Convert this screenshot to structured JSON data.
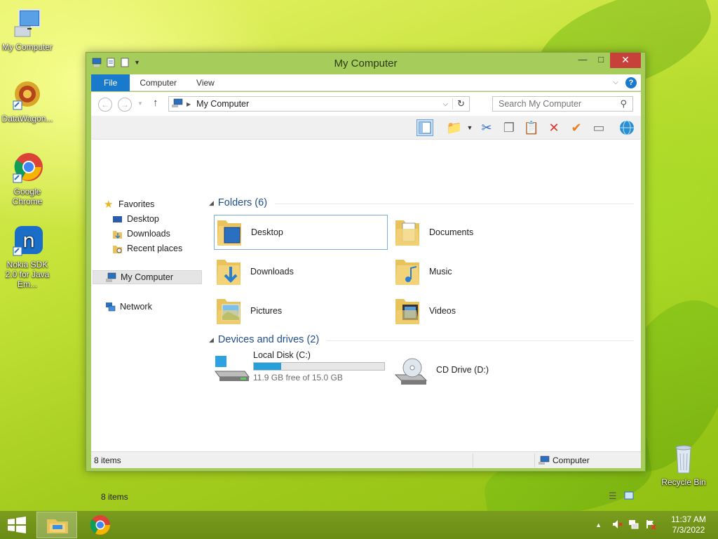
{
  "desktop": {
    "icons": [
      {
        "label": "My Computer"
      },
      {
        "label": "DataWagon..."
      },
      {
        "label": "Google Chrome"
      },
      {
        "label": "Nokia SDK 2.0 for Java Em..."
      },
      {
        "label": "Recycle Bin"
      }
    ]
  },
  "window": {
    "title": "My Computer",
    "tabs": [
      {
        "label": "File"
      },
      {
        "label": "Computer"
      },
      {
        "label": "View"
      }
    ],
    "address": {
      "path": "My Computer",
      "search_placeholder": "Search My Computer"
    },
    "nav": {
      "favorites": "Favorites",
      "favorites_items": [
        {
          "label": "Desktop"
        },
        {
          "label": "Downloads"
        },
        {
          "label": "Recent places"
        }
      ],
      "my_computer": "My Computer",
      "network": "Network"
    },
    "folders_header": "Folders (6)",
    "folders": [
      {
        "label": "Desktop"
      },
      {
        "label": "Documents"
      },
      {
        "label": "Downloads"
      },
      {
        "label": "Music"
      },
      {
        "label": "Pictures"
      },
      {
        "label": "Videos"
      }
    ],
    "drives_header": "Devices and drives (2)",
    "drives": [
      {
        "label": "Local Disk (C:)",
        "free_text": "11.9 GB free of 15.0 GB",
        "used_fraction": 0.207
      },
      {
        "label": "CD Drive (D:)"
      }
    ],
    "items_count": "8 items",
    "status": {
      "count": "8 items",
      "location": "Computer"
    }
  },
  "taskbar": {
    "clock_time": "11:37 AM",
    "clock_date": "7/3/2022"
  },
  "colors": {
    "accent": "#1979ca",
    "progress": "#26a0da",
    "close": "#c7403a"
  }
}
